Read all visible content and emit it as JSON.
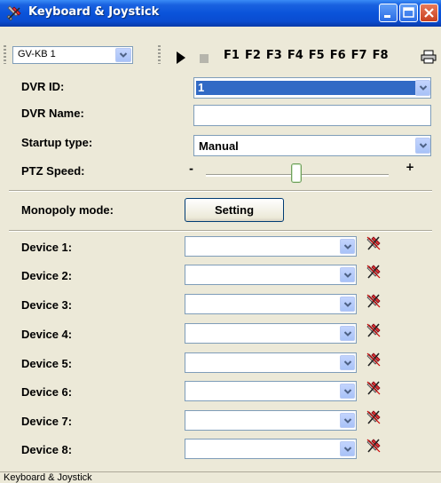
{
  "window": {
    "title": "Keyboard & Joystick"
  },
  "toolbar": {
    "keyboard_select": "GV-KB 1",
    "function_keys": [
      "F1",
      "F2",
      "F3",
      "F4",
      "F5",
      "F6",
      "F7",
      "F8"
    ]
  },
  "form": {
    "dvr_id": {
      "label": "DVR ID:",
      "value": "1"
    },
    "dvr_name": {
      "label": "DVR Name:",
      "value": ""
    },
    "startup_type": {
      "label": "Startup type:",
      "value": "Manual"
    },
    "ptz_speed": {
      "label": "PTZ Speed:",
      "min_label": "-",
      "max_label": "+",
      "level": 0.5
    },
    "monopoly_mode": {
      "label": "Monopoly mode:",
      "button": "Setting"
    }
  },
  "devices": [
    {
      "label": "Device 1:",
      "value": ""
    },
    {
      "label": "Device 2:",
      "value": ""
    },
    {
      "label": "Device 3:",
      "value": ""
    },
    {
      "label": "Device 4:",
      "value": ""
    },
    {
      "label": "Device 5:",
      "value": ""
    },
    {
      "label": "Device 6:",
      "value": ""
    },
    {
      "label": "Device 7:",
      "value": ""
    },
    {
      "label": "Device 8:",
      "value": ""
    }
  ],
  "status_bar": {
    "text": "Keyboard & Joystick"
  }
}
